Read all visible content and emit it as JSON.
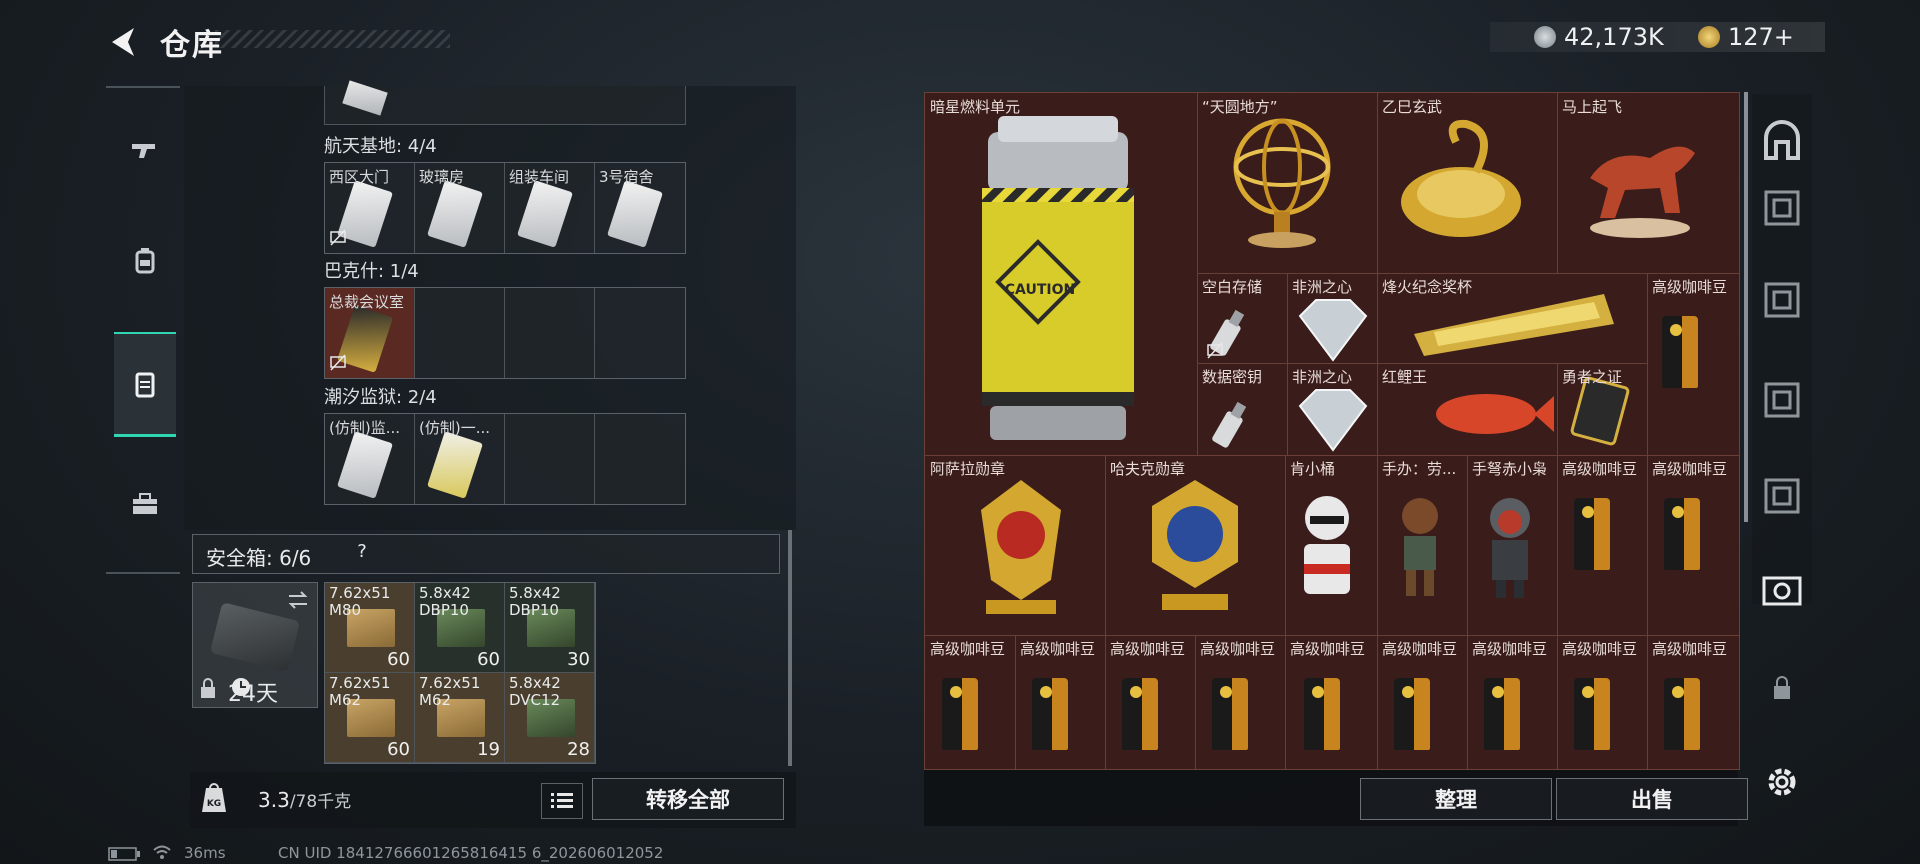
{
  "header": {
    "title": "仓库",
    "currency_silver": "42,173K",
    "currency_gold": "127+"
  },
  "left_tabs": [
    "gun-icon",
    "backpack-icon",
    "vest-icon",
    "toolbox-icon"
  ],
  "keycards": {
    "top_partial": "",
    "sections": [
      {
        "label": "航天基地: 4/4",
        "slots": [
          "西区大门",
          "玻璃房",
          "组装车间",
          "3号宿舍"
        ]
      },
      {
        "label": "巴克什: 1/4",
        "slots": [
          "总裁会议室",
          "",
          "",
          ""
        ]
      },
      {
        "label": "潮汐监狱: 2/4",
        "slots": [
          "(仿制)监...",
          "(仿制)一...",
          "",
          ""
        ]
      }
    ]
  },
  "safe_box": {
    "title": "安全箱: 6/6",
    "help": "?",
    "days": "24天",
    "ammo": [
      {
        "cal": "7.62x51",
        "name": "M80",
        "count": "60"
      },
      {
        "cal": "5.8x42",
        "name": "DBP10",
        "count": "60"
      },
      {
        "cal": "5.8x42",
        "name": "DBP10",
        "count": "30"
      },
      {
        "cal": "7.62x51",
        "name": "M62",
        "count": "60"
      },
      {
        "cal": "7.62x51",
        "name": "M62",
        "count": "19"
      },
      {
        "cal": "5.8x42",
        "name": "DVC12",
        "count": "28"
      }
    ]
  },
  "weight": {
    "current": "3.3",
    "capacity": "/78千克"
  },
  "buttons": {
    "transfer_all": "转移全部",
    "sort": "整理",
    "sell": "出售"
  },
  "status": {
    "ping": "36ms",
    "uid": "CN UID 18412766601265816415 6_202606012052"
  },
  "stash_items": {
    "fuel": "暗星燃料单元",
    "globe": "“天圆地方”",
    "turtle": "乙巳玄武",
    "horse": "马上起飞",
    "blank_storage": "空白存储",
    "africa_heart_1": "非洲之心",
    "trophy": "烽火纪念奖杯",
    "coffee_1": "高级咖啡豆",
    "data_key": "数据密钥",
    "africa_heart_2": "非洲之心",
    "koi": "红鲤王",
    "hero_proof": "勇者之证",
    "asala_medal": "阿萨拉勋章",
    "haff_medal": "哈夫克勋章",
    "kfc": "肯小桶",
    "figure_1": "手办：劳...",
    "figure_2": "手弩赤小枭",
    "coffee_2": "高级咖啡豆",
    "coffee_3": "高级咖啡豆",
    "coffee_row": [
      "高级咖啡豆",
      "高级咖啡豆",
      "高级咖啡豆",
      "高级咖啡豆",
      "高级咖啡豆",
      "高级咖啡豆",
      "高级咖啡豆",
      "高级咖啡豆",
      "高级咖啡豆"
    ]
  },
  "colors": {
    "accent": "#2fd6b0",
    "stash_bg": "#3a1c1a",
    "gold": "#d8b040"
  },
  "right_sidebar": [
    "arch-icon",
    "grid-icon-1",
    "grid-icon-2",
    "grid-icon-3",
    "grid-icon-4",
    "camera-icon",
    "lock-icon",
    "gear-icon"
  ]
}
